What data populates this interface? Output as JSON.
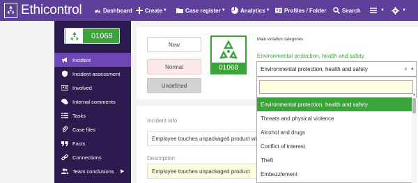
{
  "app": {
    "logo_text": "Ethicontrol"
  },
  "nav": {
    "dashboard": "Dashboard",
    "create": "Create",
    "case_register": "Case register",
    "analytics": "Analytics",
    "profiles": "Profiles / Folder",
    "search": "Search"
  },
  "sidebar": {
    "case_number": "01068",
    "items": [
      {
        "label": "Incident",
        "icon": "megaphone-icon"
      },
      {
        "label": "Incident assessment",
        "icon": "shield-icon"
      },
      {
        "label": "Involved",
        "icon": "id-card-icon"
      },
      {
        "label": "Internal comments",
        "icon": "comments-icon"
      },
      {
        "label": "Tasks",
        "icon": "list-icon"
      },
      {
        "label": "Case files",
        "icon": "paperclip-icon"
      },
      {
        "label": "Facts",
        "icon": "quote-icon"
      },
      {
        "label": "Connections",
        "icon": "link-icon"
      },
      {
        "label": "Team conclusions",
        "icon": "users-icon"
      }
    ]
  },
  "status": {
    "new_label": "New",
    "normal_label": "Normal",
    "undefined_label": "Undefined",
    "case_number": "01068"
  },
  "categories": {
    "heading": "Main violation categories",
    "selected_title": "Environmental protection, health and safety",
    "selected_value": "Environmental protection, health and safety",
    "options": [
      "Environmental protection, health and safety",
      "Threats and physical violence",
      "Alcohol and drugs",
      "Conflict of interest",
      "Theft",
      "Embezzlement"
    ]
  },
  "incident": {
    "info_label": "Incident info",
    "info_value": "Employee touches unpackaged product wi",
    "description_label": "Description",
    "description_value": "Employee touches unpackaged product"
  },
  "colors": {
    "topbar": "#5e3f9a",
    "sidebar": "#2d1a4f",
    "active": "#6d47b5",
    "green": "#3aa33a"
  }
}
